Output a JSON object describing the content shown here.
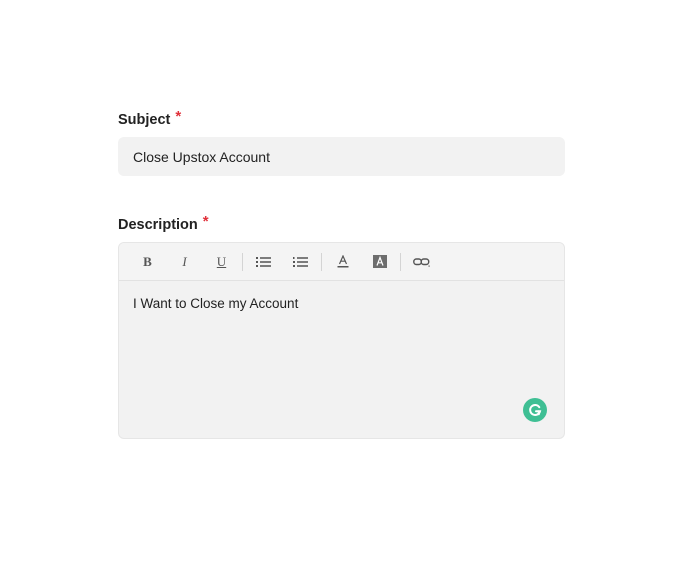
{
  "subject": {
    "label": "Subject",
    "required_mark": "*",
    "value": "Close Upstox Account"
  },
  "description": {
    "label": "Description",
    "required_mark": "*",
    "value": "I Want to Close my Account"
  },
  "toolbar": {
    "bold_label": "B",
    "italic_label": "I",
    "underline_label": "U",
    "icons": [
      "bold-icon",
      "italic-icon",
      "underline-icon",
      "bullet-list-icon",
      "numbered-list-icon",
      "font-color-icon",
      "background-color-icon",
      "link-icon"
    ]
  },
  "colors": {
    "required": "#e0303a",
    "field_background": "#f2f2f2",
    "grammarly": "#3fbf94"
  }
}
